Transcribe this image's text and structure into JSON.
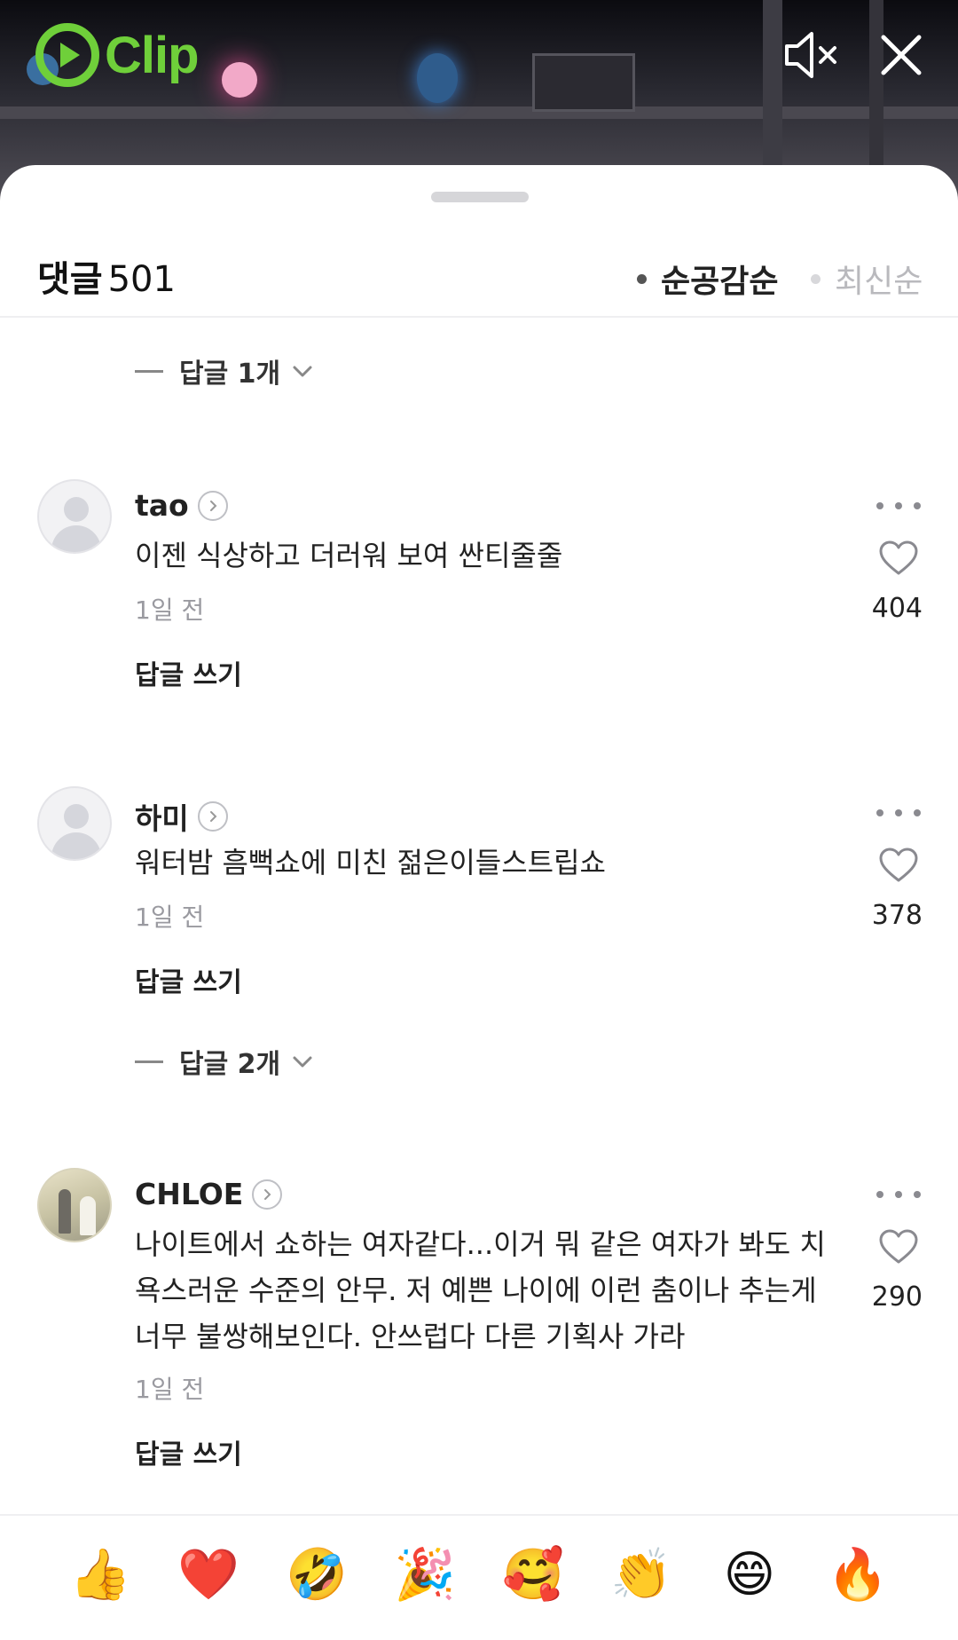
{
  "brand": {
    "logo_text": "Clip"
  },
  "header": {
    "title": "댓글",
    "count": "501",
    "sort_options": [
      "순공감순",
      "최신순"
    ],
    "active_sort": "순공감순"
  },
  "reply_toggles": [
    "답글 1개",
    "답글 2개"
  ],
  "comments": [
    {
      "username": "tao",
      "text": "이젠 식상하고 더러워 보여 싼티줄줄",
      "time": "1일 전",
      "likes": "404",
      "write_reply": "답글 쓰기"
    },
    {
      "username": "하미",
      "text": "워터밤 흠뻑쇼에 미친 젊은이들스트립쇼",
      "time": "1일 전",
      "likes": "378",
      "write_reply": "답글 쓰기"
    },
    {
      "username": "CHLOE",
      "text": "나이트에서 쇼하는 여자같다...이거 뭐 같은 여자가 봐도 치욕스러운 수준의 안무. 저 예쁜 나이에 이런 춤이나 추는게 너무 불쌍해보인다. 안쓰럽다 다른 기획사 가라",
      "time": "1일 전",
      "likes": "290",
      "write_reply": "답글 쓰기"
    }
  ],
  "emoji_reactions": [
    "👍",
    "❤️",
    "🤣",
    "🎉",
    "🥰",
    "👏",
    "😄",
    "🔥"
  ],
  "colors": {
    "brand_green": "#6fcf3a",
    "muted": "#9a9aa0"
  },
  "icons": [
    "mute-icon",
    "close-icon",
    "chevron-down-icon",
    "profile-arrow-icon",
    "more-icon",
    "heart-icon"
  ]
}
